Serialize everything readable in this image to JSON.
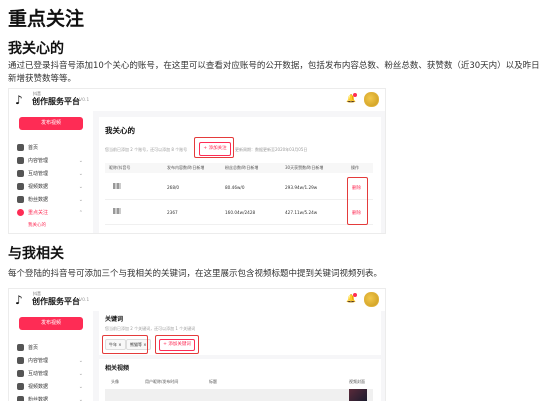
{
  "heading_main": "重点关注",
  "section1": {
    "title": "我关心的",
    "paragraph": "通过已登录抖音号添加10个关心的账号，在这里可以查看对应账号的公开数据，包括发布内容总数、粉丝总数、获赞数（近30天内）以及昨日新增获赞数等等。"
  },
  "section2": {
    "title": "与我相关",
    "paragraph": "每个登陆的抖音号可添加三个与我相关的关键词，在这里展示包含视频标题中提到关键词视频列表。"
  },
  "app": {
    "brand_small": "抖音",
    "brand": "创作服务平台",
    "version": "V0.1",
    "publish_label": "发布视频",
    "nav": [
      {
        "label": "首页"
      },
      {
        "label": "内容管理"
      },
      {
        "label": "互动管理"
      },
      {
        "label": "视频数据"
      },
      {
        "label": "粉丝数据"
      },
      {
        "label": "重点关注"
      }
    ],
    "nav_sub": "我关心的"
  },
  "shot1": {
    "panel_title": "我关心的",
    "desc_left": "您当前已添加 2 个账号，还可以添加 8 个账号",
    "add_button": "+ 添加关注",
    "desc_right": "更新周期：数据更新至2020年03月05日",
    "columns": [
      "昵称/抖音号",
      "发布内容数/昨日新增",
      "粉丝总数/昨日新增",
      "30天获赞数/昨日新增",
      "操作"
    ],
    "rows": [
      {
        "posts": "268/0",
        "fans": "80.46w/0",
        "likes": "293.94w/1.29w",
        "action": "删除"
      },
      {
        "posts": "2367",
        "fans": "160.04w/2428",
        "likes": "427.11w/5.24w",
        "action": "删除"
      }
    ]
  },
  "shot2": {
    "panel_title": "关键词",
    "desc": "您当前已添加 2 个关键词，还可以添加 1 个关键词",
    "tags": [
      "牛年 ×",
      "熊猫等 ×"
    ],
    "add_button": "+ 添加关键词",
    "section_title": "相关视频",
    "columns": [
      "头像",
      "用户昵称/发布时间",
      "标题",
      "视频封面"
    ]
  }
}
